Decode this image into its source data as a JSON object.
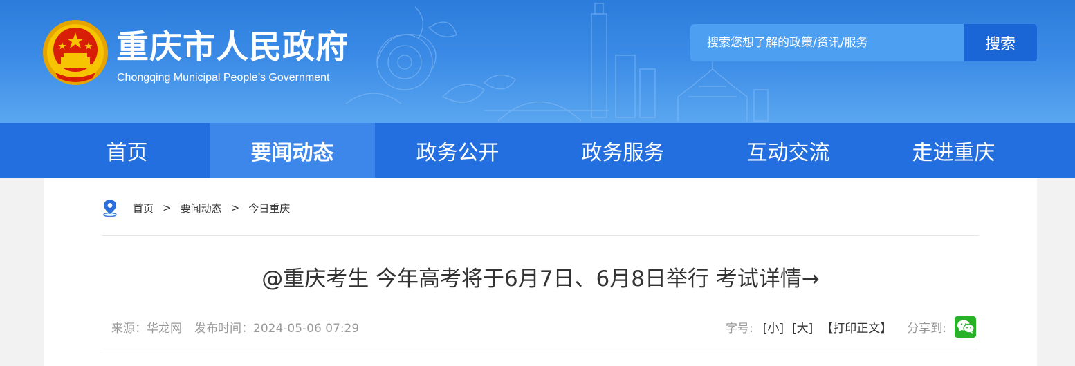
{
  "header": {
    "site_title_cn": "重庆市人民政府",
    "site_title_en": "Chongqing Municipal People’s Government",
    "emblem_icon": "national-emblem-icon",
    "search": {
      "placeholder": "搜索您想了解的政策/资讯/服务",
      "button_label": "搜索"
    }
  },
  "nav": {
    "items": [
      {
        "label": "首页"
      },
      {
        "label": "要闻动态",
        "active": true
      },
      {
        "label": "政务公开"
      },
      {
        "label": "政务服务"
      },
      {
        "label": "互动交流"
      },
      {
        "label": "走进重庆"
      }
    ]
  },
  "breadcrumb": {
    "icon": "location-pin-icon",
    "items": [
      "首页",
      "要闻动态",
      "今日重庆"
    ],
    "separator": ">"
  },
  "article": {
    "title": "@重庆考生 今年高考将于6月7日、6月8日举行 考试详情→",
    "source": "来源：华龙网",
    "publish_time": "发布时间：2024-05-06 07:29",
    "font_size_label": "字号:",
    "font_small": "[小]",
    "font_large": "[大]",
    "print_label": "【打印正文】",
    "share_label": "分享到:",
    "share_icon": "wechat-icon"
  },
  "colors": {
    "header_top": "#2c7cdc",
    "nav_bg": "#246fdf",
    "nav_active": "#3d86ea",
    "search_bg": "#4d9ff2",
    "search_button": "#1b66d6",
    "wechat_green": "#27b227"
  }
}
